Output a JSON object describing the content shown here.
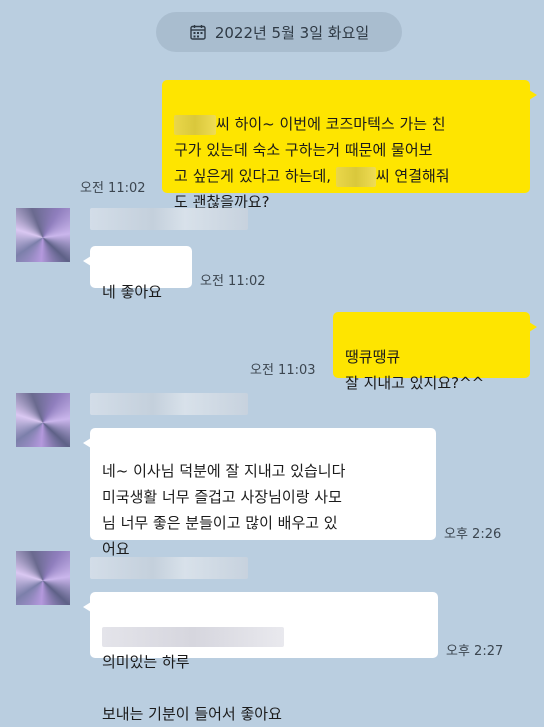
{
  "date_separator": {
    "label": "2022년 5월 3일 화요일",
    "icon": "calendar-icon"
  },
  "messages": [
    {
      "sender": "me",
      "redaction_lead": "",
      "text_1": "씨 하이~ 이번에 코즈마텍스 가는 친\n구가 있는데 숙소 구하는거 때문에 물어보\n고 싶은게 있다고 하는데, ",
      "text_2": "씨 연결해줘\n도 괜찮을까요?",
      "time": "오전 11:02"
    },
    {
      "sender": "other",
      "text": "네 좋아요",
      "time": "오전 11:02"
    },
    {
      "sender": "me",
      "text": "땡큐땡큐\n잘 지내고 있지요?^^",
      "time": "오전 11:03"
    },
    {
      "sender": "other",
      "text": "네~ 이사님 덕분에 잘 지내고 있습니다\n미국생활 너무 즐겁고 사장님이랑 사모\n님 너무 좋은 분들이고 많이 배우고 있\n어요",
      "time": "오후 2:26"
    },
    {
      "sender": "other",
      "text_1": "의미있는 하루",
      "text_2": "보내는 기분이 들어서 좋아요",
      "time": "오후 2:27"
    }
  ],
  "colors": {
    "background": "#bacee0",
    "my_bubble": "#fee500",
    "their_bubble": "#ffffff",
    "date_pill": "#a9bdcf"
  }
}
